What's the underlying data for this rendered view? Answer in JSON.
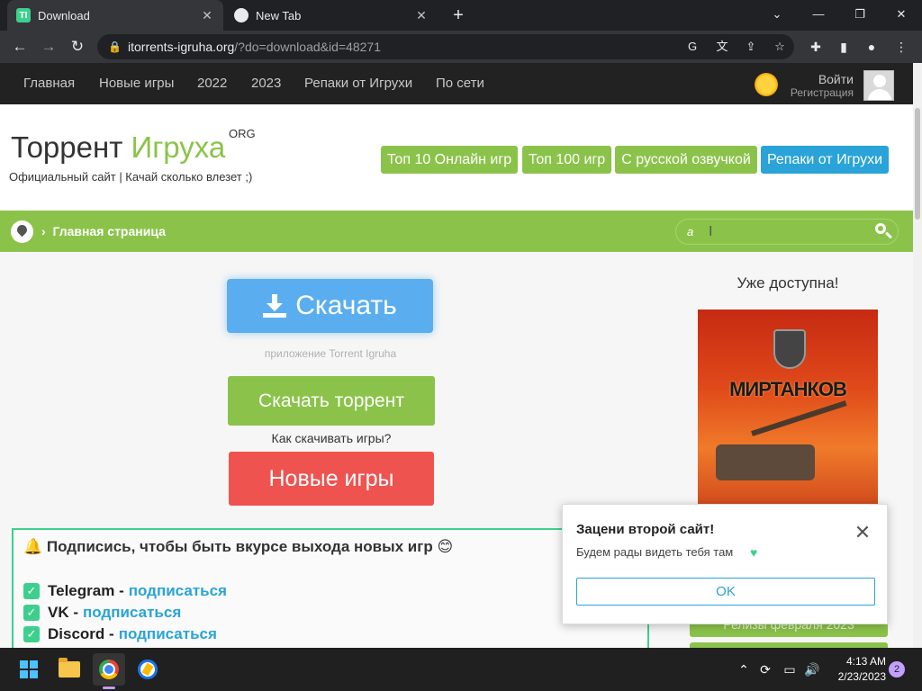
{
  "browser": {
    "tabs": [
      {
        "title": "Download",
        "favicon": "TI"
      },
      {
        "title": "New Tab"
      }
    ],
    "url_domain": "itorrents-igruha.org",
    "url_path": "/?do=download&id=48271"
  },
  "site": {
    "nav": [
      "Главная",
      "Новые игры",
      "2022",
      "2023",
      "Репаки от Игрухи",
      "По сети"
    ],
    "login": "Войти",
    "register": "Регистрация",
    "logo_part1": "Торрент",
    "logo_part2": "Игруха",
    "logo_suffix": "ORG",
    "tagline": "Официальный сайт | Качай сколько влезет ;)",
    "header_buttons": [
      {
        "label": "Топ 10 Онлайн игр",
        "color": "#8bc34a"
      },
      {
        "label": "Топ 100 игр",
        "color": "#8bc34a"
      },
      {
        "label": "С русской озвучкой",
        "color": "#8bc34a"
      },
      {
        "label": "Репаки от Игрухи",
        "color": "#29a3d8"
      }
    ],
    "breadcrumb": "Главная страница",
    "search_value": "a"
  },
  "main": {
    "download_label": "Скачать",
    "app_caption": "приложение Torrent Igruha",
    "torrent_label": "Скачать торрент",
    "howto": "Как скачивать игры?",
    "newgames_label": "Новые игры",
    "subscribe_title": "Подписись, чтобы быть вкурсе выхода новых игр",
    "subscribe_rows": [
      {
        "name": "Telegram",
        "sep": "-",
        "link": "подписаться"
      },
      {
        "name": "VK",
        "sep": "-",
        "link": "подписаться"
      },
      {
        "name": "Discord",
        "sep": "-",
        "link": "подписаться"
      }
    ]
  },
  "sidebar": {
    "title": "Уже доступна!",
    "ad_title": "МИРТАНКОВ",
    "button1": "Релизы февраля 2023"
  },
  "popup": {
    "title": "Зацени второй сайт!",
    "text": "Будем рады видеть тебя там",
    "ok": "OK"
  },
  "taskbar": {
    "time": "4:13 AM",
    "date": "2/23/2023",
    "notifications": "2"
  },
  "colors": {
    "green": "#8bc34a",
    "blue": "#29a3d8",
    "red": "#ef5350",
    "download_blue": "#5aaef0",
    "accent_green": "#3ecf8e"
  }
}
